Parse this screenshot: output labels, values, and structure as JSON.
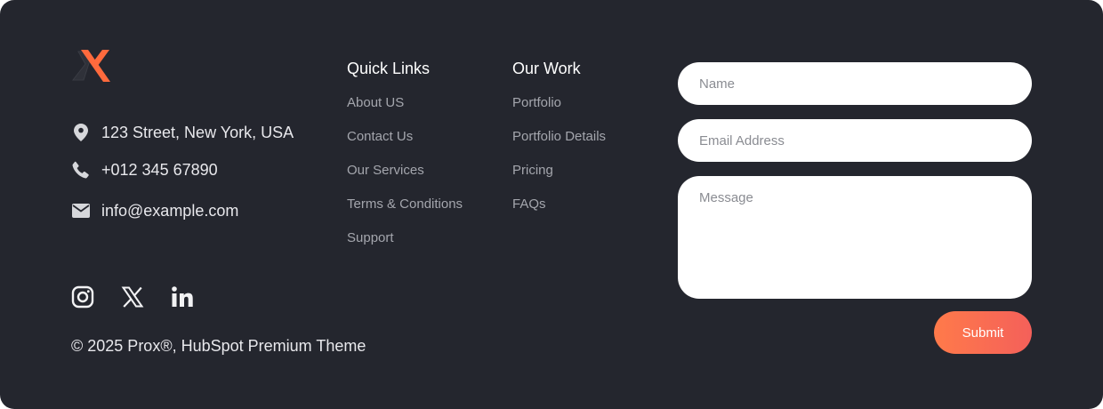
{
  "brand": {
    "accent": "#ff6a3d",
    "background": "#24262e"
  },
  "contact": {
    "address": "123 Street, New York, USA",
    "phone": "+012 345 67890",
    "email": "info@example.com"
  },
  "social": [
    "instagram-icon",
    "x-icon",
    "linkedin-icon"
  ],
  "copyright": "© 2025 Prox®, HubSpot Premium Theme",
  "quick_links": {
    "title": "Quick Links",
    "items": [
      "About US",
      "Contact Us",
      "Our Services",
      "Terms & Conditions",
      "Support"
    ]
  },
  "our_work": {
    "title": "Our Work",
    "items": [
      "Portfolio",
      "Portfolio Details",
      "Pricing",
      "FAQs"
    ]
  },
  "form": {
    "name_placeholder": "Name",
    "email_placeholder": "Email Address",
    "message_placeholder": "Message",
    "submit_label": "Submit"
  }
}
